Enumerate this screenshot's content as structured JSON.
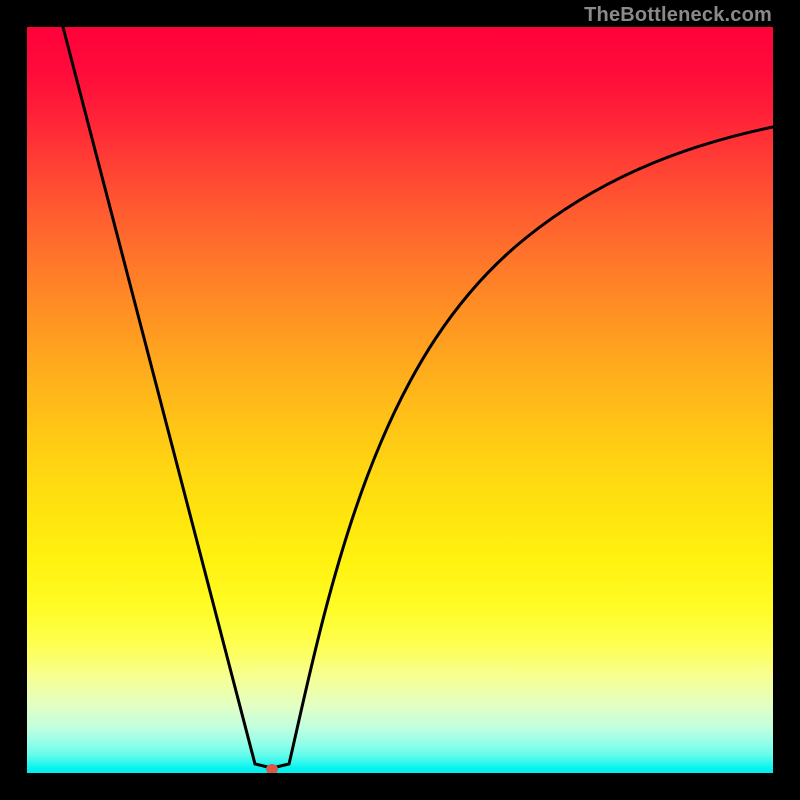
{
  "watermark": "TheBottleneck.com",
  "chart_data": {
    "type": "line",
    "title": "",
    "xlabel": "",
    "ylabel": "",
    "xlim": [
      0,
      100
    ],
    "ylim": [
      0,
      100
    ],
    "background": {
      "style": "vertical-gradient",
      "stops": [
        {
          "pos": 0.0,
          "color": "#ff013a"
        },
        {
          "pos": 0.12,
          "color": "#ff2238"
        },
        {
          "pos": 0.24,
          "color": "#ff5830"
        },
        {
          "pos": 0.36,
          "color": "#ff8826"
        },
        {
          "pos": 0.48,
          "color": "#ffb31b"
        },
        {
          "pos": 0.6,
          "color": "#ffd811"
        },
        {
          "pos": 0.72,
          "color": "#fff311"
        },
        {
          "pos": 0.83,
          "color": "#feff53"
        },
        {
          "pos": 0.91,
          "color": "#e3ffc4"
        },
        {
          "pos": 0.96,
          "color": "#94fee8"
        },
        {
          "pos": 1.0,
          "color": "#00efef"
        }
      ]
    },
    "series": [
      {
        "name": "bottleneck-curve",
        "x": [
          5,
          10,
          15,
          20,
          25,
          28,
          30,
          31,
          33,
          35,
          38,
          42,
          47,
          53,
          60,
          68,
          78,
          90,
          100
        ],
        "y": [
          100,
          81,
          62,
          43,
          24,
          10,
          3,
          1,
          0.5,
          1,
          5,
          15,
          30,
          45,
          58,
          68,
          77,
          83,
          87
        ]
      }
    ],
    "markers": [
      {
        "name": "optimal-point",
        "x": 33,
        "y": 0.5,
        "color": "#d85a4a"
      }
    ],
    "grid": false,
    "legend": false
  }
}
